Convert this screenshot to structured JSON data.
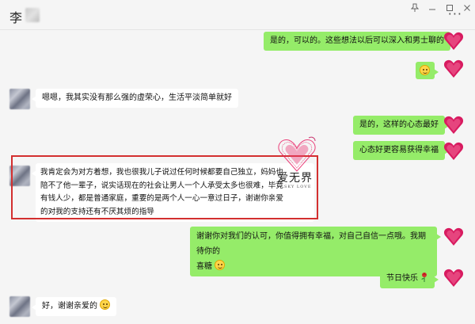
{
  "window": {
    "title": "李",
    "controls": [
      "pin-icon",
      "minimize-icon",
      "maximize-icon",
      "close-icon"
    ],
    "more_label": "···"
  },
  "colors": {
    "outgoing_bubble": "#95ec69",
    "incoming_bubble": "#ffffff",
    "highlight_border": "#d32f2f",
    "heart_avatar": "#d81b60"
  },
  "messages": [
    {
      "side": "out",
      "text": "是的，可以的。这些想法以后可以深入和男士聊的"
    },
    {
      "side": "out",
      "emoji": "smile-emoji"
    },
    {
      "side": "in",
      "text": "嗯嗯，我其实没有那么强的虚荣心，生活平淡简单就好"
    },
    {
      "side": "out",
      "text": "是的，这样的心态最好"
    },
    {
      "side": "out",
      "text": "心态好更容易获得幸福"
    },
    {
      "side": "in",
      "lines": [
        "我肯定会为对方着想，我也很我儿子说过任何时候都要自己独立，妈妈也",
        "陪不了他一辈子，说实话现在的社会让男人一个人承受太多也很难，毕竟",
        "有钱人少，都是普通家庭，重要的是两个人一心一意过日子，谢谢你亲爱",
        "的对我的支持还有不厌其烦的指导"
      ]
    },
    {
      "side": "out",
      "lines": [
        "谢谢你对我们的认可，你值得拥有幸福，对自己自信一点哦。我期待你的",
        "喜糖"
      ]
    },
    {
      "side": "out",
      "text": "节日快乐"
    },
    {
      "side": "in",
      "text": "好，谢谢亲爱的"
    }
  ],
  "watermark": {
    "text": "爱无界",
    "subtitle": "SKY LOVE"
  }
}
